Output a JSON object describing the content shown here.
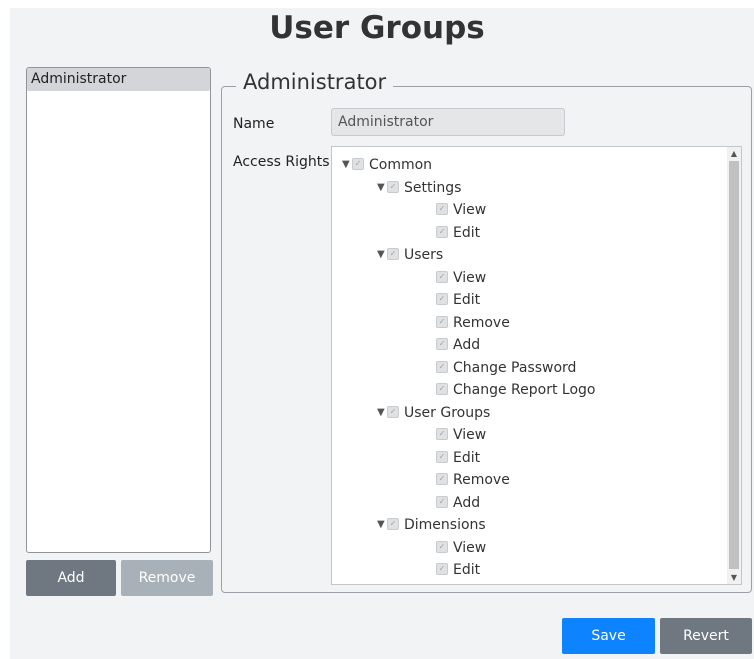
{
  "title": "User Groups",
  "groups": [
    {
      "label": "Administrator",
      "selected": true
    }
  ],
  "buttons": {
    "add": "Add",
    "remove": "Remove",
    "save": "Save",
    "revert": "Revert"
  },
  "details": {
    "legend": "Administrator",
    "name_label": "Name",
    "name_value": "Administrator",
    "access_label": "Access Rights"
  },
  "access_tree": [
    {
      "label": "Common",
      "level": 0,
      "expandable": true,
      "checked": true
    },
    {
      "label": "Settings",
      "level": 1,
      "expandable": true,
      "checked": true
    },
    {
      "label": "View",
      "level": 2,
      "expandable": false,
      "checked": true
    },
    {
      "label": "Edit",
      "level": 2,
      "expandable": false,
      "checked": true
    },
    {
      "label": "Users",
      "level": 1,
      "expandable": true,
      "checked": true
    },
    {
      "label": "View",
      "level": 2,
      "expandable": false,
      "checked": true
    },
    {
      "label": "Edit",
      "level": 2,
      "expandable": false,
      "checked": true
    },
    {
      "label": "Remove",
      "level": 2,
      "expandable": false,
      "checked": true
    },
    {
      "label": "Add",
      "level": 2,
      "expandable": false,
      "checked": true
    },
    {
      "label": "Change Password",
      "level": 2,
      "expandable": false,
      "checked": true
    },
    {
      "label": "Change Report Logo",
      "level": 2,
      "expandable": false,
      "checked": true
    },
    {
      "label": "User Groups",
      "level": 1,
      "expandable": true,
      "checked": true
    },
    {
      "label": "View",
      "level": 2,
      "expandable": false,
      "checked": true
    },
    {
      "label": "Edit",
      "level": 2,
      "expandable": false,
      "checked": true
    },
    {
      "label": "Remove",
      "level": 2,
      "expandable": false,
      "checked": true
    },
    {
      "label": "Add",
      "level": 2,
      "expandable": false,
      "checked": true
    },
    {
      "label": "Dimensions",
      "level": 1,
      "expandable": true,
      "checked": true
    },
    {
      "label": "View",
      "level": 2,
      "expandable": false,
      "checked": true
    },
    {
      "label": "Edit",
      "level": 2,
      "expandable": false,
      "checked": true
    }
  ],
  "colors": {
    "accent": "#0d83ff",
    "secondary_button": "#6f7880",
    "disabled_button": "#a9b1b8",
    "panel_bg": "#f2f3f4"
  }
}
